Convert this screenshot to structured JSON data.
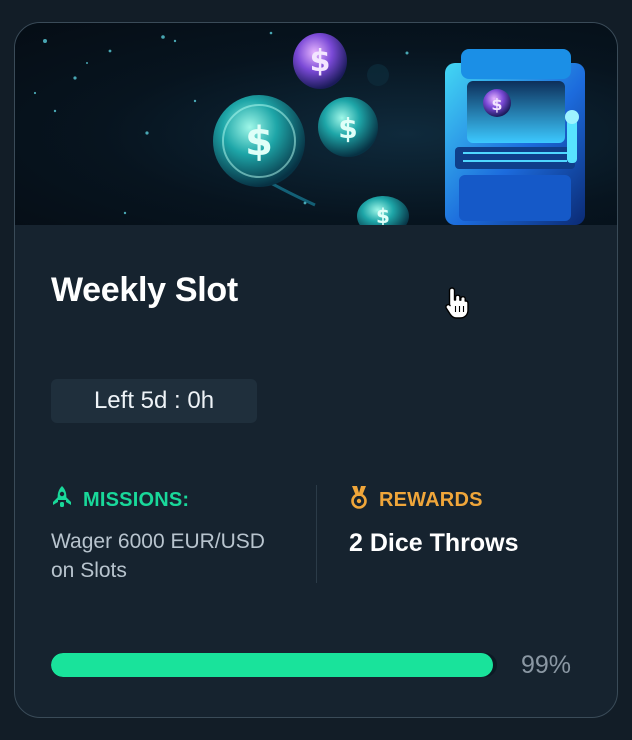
{
  "card": {
    "title": "Weekly Slot",
    "time_left": "Left 5d : 0h",
    "missions": {
      "heading": "MISSIONS:",
      "icon": "rocket-icon",
      "description": "Wager 6000 EUR/USD on Slots"
    },
    "rewards": {
      "heading": "REWARDS",
      "icon": "medal-icon",
      "value": "2 Dice Throws"
    },
    "progress": {
      "percent": 99,
      "label": "99%"
    }
  },
  "colors": {
    "missions_accent": "#19d89a",
    "rewards_accent": "#f0a63a",
    "progress_fill": "#19e39b",
    "card_bg": "#16232f"
  }
}
